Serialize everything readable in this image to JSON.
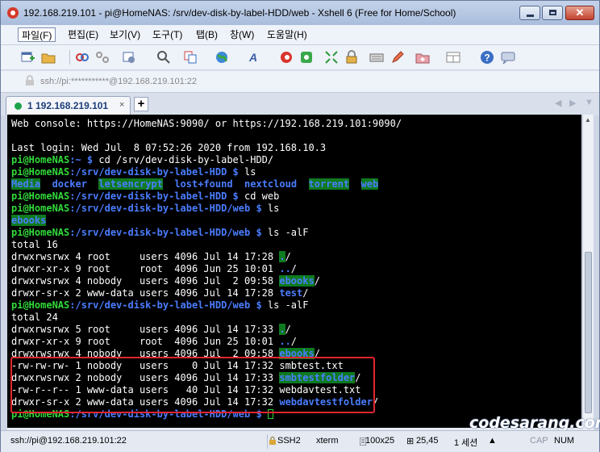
{
  "window": {
    "title": "192.168.219.101 - pi@HomeNAS: /srv/dev-disk-by-label-HDD/web - Xshell 6 (Free for Home/School)",
    "controls": {
      "minimize": "minimize-icon",
      "maximize": "maximize-icon",
      "close": "close-icon",
      "close_glyph": "✕"
    }
  },
  "menu": [
    "파일(F)",
    "편집(E)",
    "보기(V)",
    "도구(T)",
    "탭(B)",
    "창(W)",
    "도움말(H)"
  ],
  "toolbar_icons": [
    "new-session-icon",
    "open-folder-icon",
    "reconnect-icon",
    "disconnect-icon",
    "properties-icon",
    "find-icon",
    "copy-icon",
    "globe-icon",
    "font-icon",
    "xshell-icon",
    "xftp-icon",
    "fullscreen-icon",
    "lock-icon",
    "keyboard-icon",
    "compose-icon",
    "new-tab-icon",
    "layout-icon",
    "help-icon",
    "chat-icon"
  ],
  "address": {
    "text": "ssh://pi:***********@192.168.219.101:22"
  },
  "tabs": [
    {
      "label": "1 192.168.219.101",
      "close": "×"
    }
  ],
  "tab_add": "+",
  "terminal": {
    "line1": "Web console: https://HomeNAS:9090/ or https://192.168.219.101:9090/",
    "line3": "Last login: Wed Jul  8 07:52:26 2020 from 192.168.10.3",
    "prompt_user": "pi@HomeNAS",
    "prompt_home_path": ":~ $ ",
    "prompt_hdd_path": ":/srv/dev-disk-by-label-HDD $ ",
    "prompt_web_path": ":/srv/dev-disk-by-label-HDD/web $ ",
    "cmd_cd_hdd": "cd /srv/dev-disk-by-label-HDD/",
    "cmd_ls": "ls",
    "cmd_cd_web": "cd web",
    "cmd_ls_alf": "ls -alF",
    "ls_hdd": [
      "Media",
      "docker",
      "letsencrypt",
      "lost+found",
      "nextcloud",
      "torrent",
      "web"
    ],
    "ls_web": "ebooks",
    "total1": "total 16",
    "listing1": [
      {
        "meta": "drwxrwsrwx 4 root     users 4096 Jul 14 17:28 ",
        "name": ".",
        "suffix": "/",
        "style": "dir-hl"
      },
      {
        "meta": "drwxr-xr-x 9 root     root  4096 Jun 25 10:01 ",
        "name": "..",
        "suffix": "/",
        "style": "dir"
      },
      {
        "meta": "drwxrwsrwx 4 nobody   users 4096 Jul  2 09:58 ",
        "name": "ebooks",
        "suffix": "/",
        "style": "dir-hl"
      },
      {
        "meta": "drwxr-sr-x 2 www-data users 4096 Jul 14 17:28 ",
        "name": "test",
        "suffix": "/",
        "style": "dir"
      }
    ],
    "total2": "total 24",
    "listing2": [
      {
        "meta": "drwxrwsrwx 5 root     users 4096 Jul 14 17:33 ",
        "name": ".",
        "suffix": "/",
        "style": "dir-hl"
      },
      {
        "meta": "drwxr-xr-x 9 root     root  4096 Jun 25 10:01 ",
        "name": "..",
        "suffix": "/",
        "style": "dir"
      },
      {
        "meta": "drwxrwsrwx 4 nobody   users 4096 Jul  2 09:58 ",
        "name": "ebooks",
        "suffix": "/",
        "style": "dir-hl"
      },
      {
        "meta": "-rw-rw-rw- 1 nobody   users    0 Jul 14 17:32 ",
        "name": "smbtest.txt",
        "suffix": "",
        "style": ""
      },
      {
        "meta": "drwxrwsrwx 2 nobody   users 4096 Jul 14 17:33 ",
        "name": "smbtestfolder",
        "suffix": "/",
        "style": "dir-hl"
      },
      {
        "meta": "-rw-r--r-- 1 www-data users   40 Jul 14 17:32 ",
        "name": "webdavtest.txt",
        "suffix": "",
        "style": ""
      },
      {
        "meta": "drwxr-sr-x 2 www-data users 4096 Jul 14 17:32 ",
        "name": "webdavtestfolder",
        "suffix": "/",
        "style": "dir"
      }
    ]
  },
  "watermark": "codesarang.com",
  "status": {
    "address": "ssh://pi@192.168.219.101:22",
    "protocol": "SSH2",
    "term": "xterm",
    "size": "100x25",
    "cursor": "25,45",
    "sessions": "1 세션",
    "cap": "CAP",
    "num": "NUM"
  },
  "colors": {
    "prompt_user": "#31d93a",
    "directory": "#4a7dff",
    "dir_highlight_bg": "#0f7a20",
    "highlight_box": "#e0252e"
  }
}
